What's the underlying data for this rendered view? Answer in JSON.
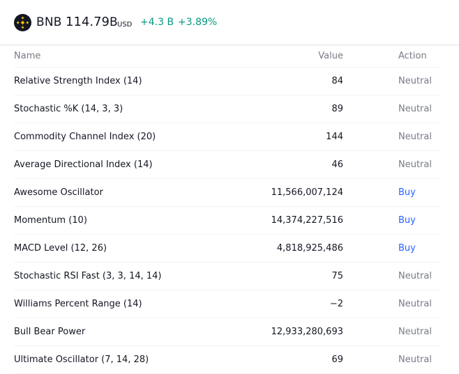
{
  "header": {
    "symbol": "BNB",
    "price": "114.79",
    "price_suffix": "B",
    "currency": "USD",
    "change_abs": "+4.3 B",
    "change_pct": "+3.89%",
    "logo_icon": "bnb-logo-icon",
    "colors": {
      "positive": "#089981",
      "logo_bg": "#131722",
      "logo_fg": "#f0b90b"
    }
  },
  "table": {
    "columns": {
      "name": "Name",
      "value": "Value",
      "action": "Action"
    },
    "rows": [
      {
        "name": "Relative Strength Index (14)",
        "value": "84",
        "action": "Neutral",
        "type": "neutral"
      },
      {
        "name": "Stochastic %K (14, 3, 3)",
        "value": "89",
        "action": "Neutral",
        "type": "neutral"
      },
      {
        "name": "Commodity Channel Index (20)",
        "value": "144",
        "action": "Neutral",
        "type": "neutral"
      },
      {
        "name": "Average Directional Index (14)",
        "value": "46",
        "action": "Neutral",
        "type": "neutral"
      },
      {
        "name": "Awesome Oscillator",
        "value": "11,566,007,124",
        "action": "Buy",
        "type": "buy"
      },
      {
        "name": "Momentum (10)",
        "value": "14,374,227,516",
        "action": "Buy",
        "type": "buy"
      },
      {
        "name": "MACD Level (12, 26)",
        "value": "4,818,925,486",
        "action": "Buy",
        "type": "buy"
      },
      {
        "name": "Stochastic RSI Fast (3, 3, 14, 14)",
        "value": "75",
        "action": "Neutral",
        "type": "neutral"
      },
      {
        "name": "Williams Percent Range (14)",
        "value": "−2",
        "action": "Neutral",
        "type": "neutral"
      },
      {
        "name": "Bull Bear Power",
        "value": "12,933,280,693",
        "action": "Neutral",
        "type": "neutral"
      },
      {
        "name": "Ultimate Oscillator (7, 14, 28)",
        "value": "69",
        "action": "Neutral",
        "type": "neutral"
      }
    ],
    "colors": {
      "neutral": "#787b86",
      "buy": "#2962ff"
    }
  }
}
